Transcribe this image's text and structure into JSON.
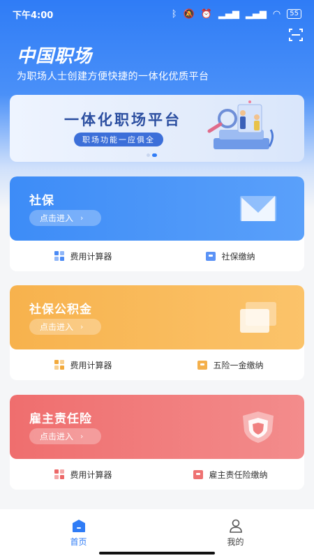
{
  "status_bar": {
    "time": "下午4:00",
    "icons": [
      "bluetooth-icon",
      "mute-icon",
      "alarm-icon",
      "signal-icon",
      "signal-icon",
      "wifi-icon"
    ],
    "battery": "55"
  },
  "header": {
    "brand": "中国职场",
    "slogan": "为职场人士创建方便快捷的一体化优质平台"
  },
  "banner": {
    "title": "一体化职场平台",
    "pill": "职场功能一应俱全",
    "page_count": 2,
    "active_page": 2
  },
  "cards": [
    {
      "title": "社保",
      "enter_label": "点击进入",
      "color": "#3d8cf7",
      "actions": [
        {
          "label": "费用计算器",
          "icon": "calculator-grid-icon"
        },
        {
          "label": "社保缴纳",
          "icon": "payment-box-icon"
        }
      ]
    },
    {
      "title": "社保公积金",
      "enter_label": "点击进入",
      "color": "#f7b24d",
      "actions": [
        {
          "label": "费用计算器",
          "icon": "calculator-grid-icon"
        },
        {
          "label": "五险一金缴纳",
          "icon": "payment-box-icon"
        }
      ]
    },
    {
      "title": "雇主责任险",
      "enter_label": "点击进入",
      "color": "#ef6e6e",
      "actions": [
        {
          "label": "费用计算器",
          "icon": "calculator-grid-icon"
        },
        {
          "label": "雇主责任险缴纳",
          "icon": "payment-box-icon"
        }
      ]
    }
  ],
  "tabbar": {
    "tabs": [
      {
        "label": "首页",
        "icon": "home-icon",
        "active": true
      },
      {
        "label": "我的",
        "icon": "user-icon",
        "active": false
      }
    ]
  }
}
